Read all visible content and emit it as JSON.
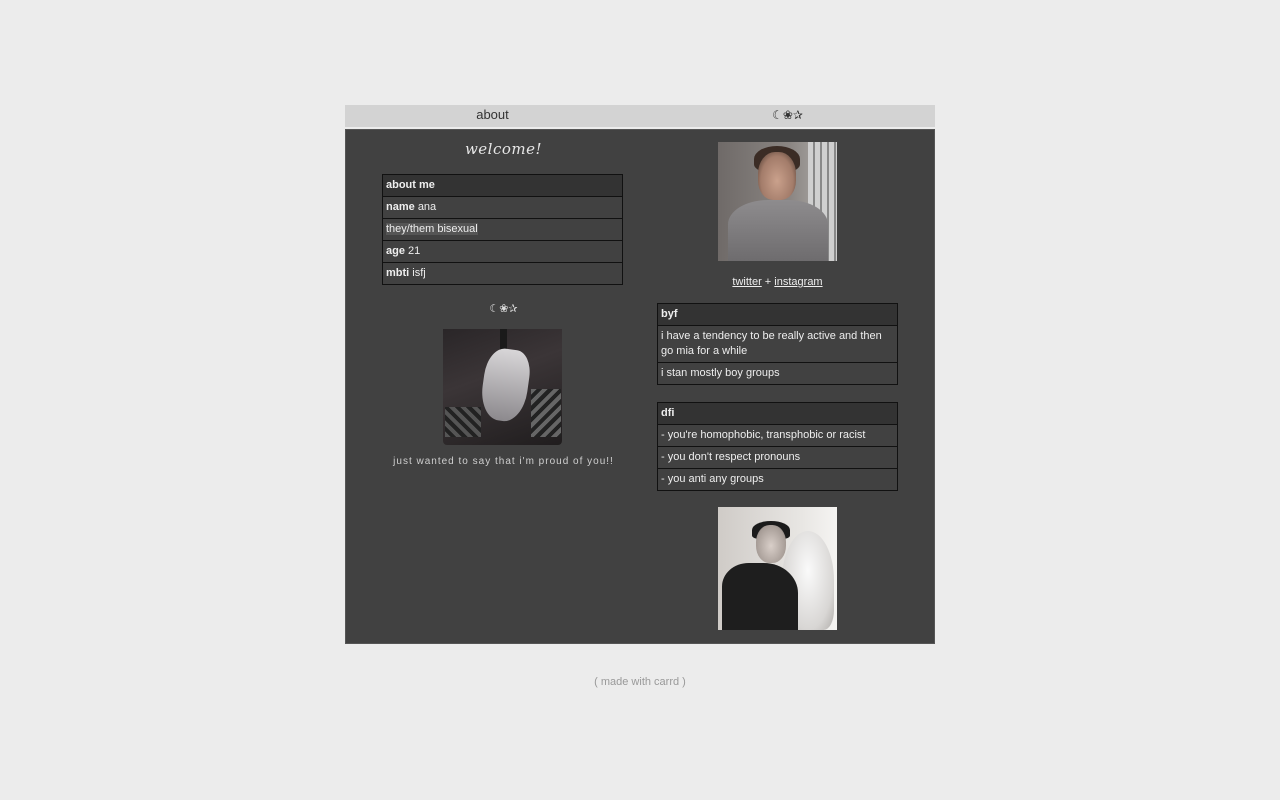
{
  "nav": {
    "about_label": "about",
    "symbols": "☾❀✰"
  },
  "left": {
    "welcome": "welcome!",
    "about_table": {
      "header": "about me",
      "rows": [
        {
          "key": "name",
          "value": "ana"
        },
        {
          "key": "",
          "value": "they/them bisexual"
        },
        {
          "key": "age",
          "value": "21"
        },
        {
          "key": "mbti",
          "value": "isfj"
        }
      ]
    },
    "symbols": "☾❀✰",
    "caption": "just wanted to say that i'm proud of you!!"
  },
  "right": {
    "links": {
      "twitter": "twitter",
      "separator": "+",
      "instagram": "instagram"
    },
    "byf_table": {
      "header": "byf",
      "rows": [
        "i have a tendency to be really active and then go mia for a while",
        "i stan mostly boy groups"
      ]
    },
    "dfi_table": {
      "header": "dfi",
      "rows": [
        "- you're homophobic, transphobic or racist",
        "- you don't respect pronouns",
        "- you anti any groups"
      ]
    }
  },
  "footer": {
    "label": "( made with carrd )"
  },
  "colors": {
    "page_bg": "#ececec",
    "topbar_bg": "#d3d3d3",
    "panel_bg": "#414141",
    "table_head_bg": "#333333",
    "text_light": "#eeeeee"
  }
}
